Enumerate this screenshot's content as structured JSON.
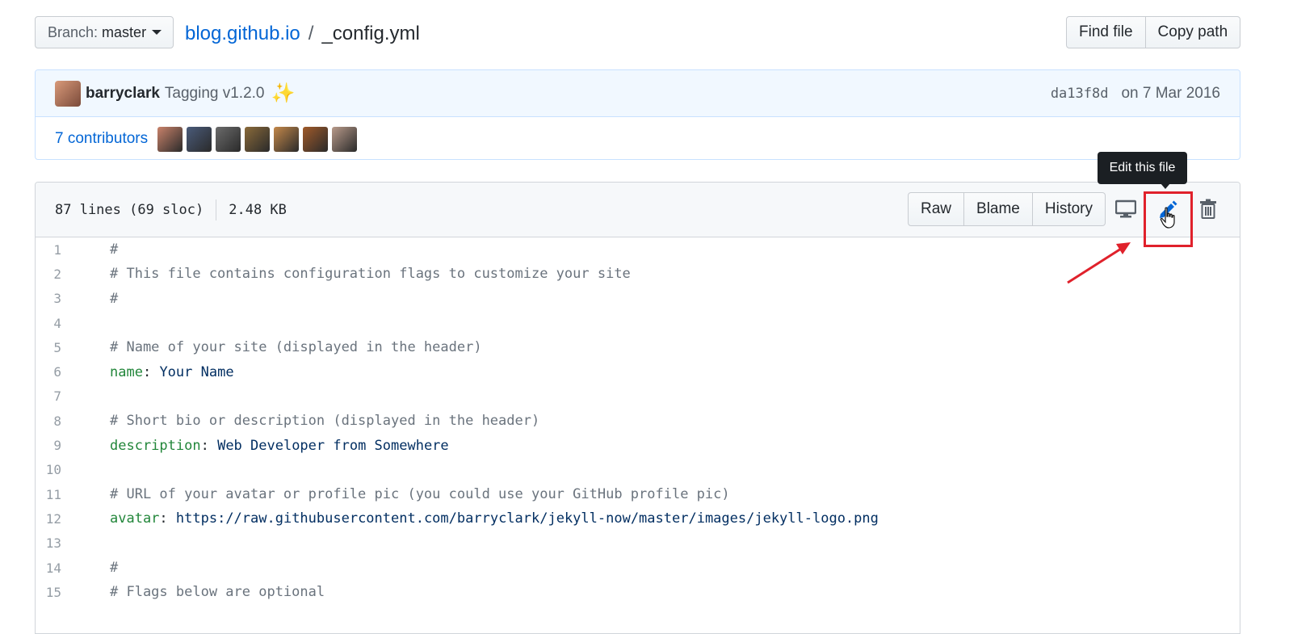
{
  "branch": {
    "prefix": "Branch:",
    "name": "master"
  },
  "breadcrumb": {
    "repo": "blog.github.io",
    "separator": "/",
    "file": "_config.yml"
  },
  "top_actions": {
    "find_file": "Find file",
    "copy_path": "Copy path"
  },
  "commit": {
    "author": "barryclark",
    "message": "Tagging v1.2.0",
    "emoji": "✨",
    "sha": "da13f8d",
    "date": "on 7 Mar 2016"
  },
  "contributors": {
    "label": "7 contributors",
    "avatars": [
      "#c9826a",
      "#4a5b7a",
      "#6b6b6b",
      "#8a6a3a",
      "#c4884a",
      "#a05a2a",
      "#b89a8a"
    ]
  },
  "file": {
    "lines_info": "87 lines (69 sloc)",
    "size": "2.48 KB",
    "actions": {
      "raw": "Raw",
      "blame": "Blame",
      "history": "History"
    },
    "icons": {
      "desktop": "desktop-icon",
      "edit": "pencil-icon",
      "delete": "trash-icon"
    },
    "tooltip": "Edit this file"
  },
  "code_lines": [
    {
      "n": "1",
      "type": "comment",
      "text": "#"
    },
    {
      "n": "2",
      "type": "comment",
      "text": "# This file contains configuration flags to customize your site"
    },
    {
      "n": "3",
      "type": "comment",
      "text": "#"
    },
    {
      "n": "4",
      "type": "blank",
      "text": ""
    },
    {
      "n": "5",
      "type": "comment",
      "text": "# Name of your site (displayed in the header)"
    },
    {
      "n": "6",
      "type": "kv",
      "key": "name",
      "value": "Your Name"
    },
    {
      "n": "7",
      "type": "blank",
      "text": ""
    },
    {
      "n": "8",
      "type": "comment",
      "text": "# Short bio or description (displayed in the header)"
    },
    {
      "n": "9",
      "type": "kv",
      "key": "description",
      "value": "Web Developer from Somewhere"
    },
    {
      "n": "10",
      "type": "blank",
      "text": ""
    },
    {
      "n": "11",
      "type": "comment",
      "text": "# URL of your avatar or profile pic (you could use your GitHub profile pic)"
    },
    {
      "n": "12",
      "type": "kv",
      "key": "avatar",
      "value": "https://raw.githubusercontent.com/barryclark/jekyll-now/master/images/jekyll-logo.png"
    },
    {
      "n": "13",
      "type": "blank",
      "text": ""
    },
    {
      "n": "14",
      "type": "comment",
      "text": "#"
    },
    {
      "n": "15",
      "type": "comment",
      "text": "# Flags below are optional"
    }
  ],
  "colors": {
    "link": "#0366d6",
    "highlight": "#e0212b",
    "key": "#22863a",
    "comment": "#6a737d"
  }
}
